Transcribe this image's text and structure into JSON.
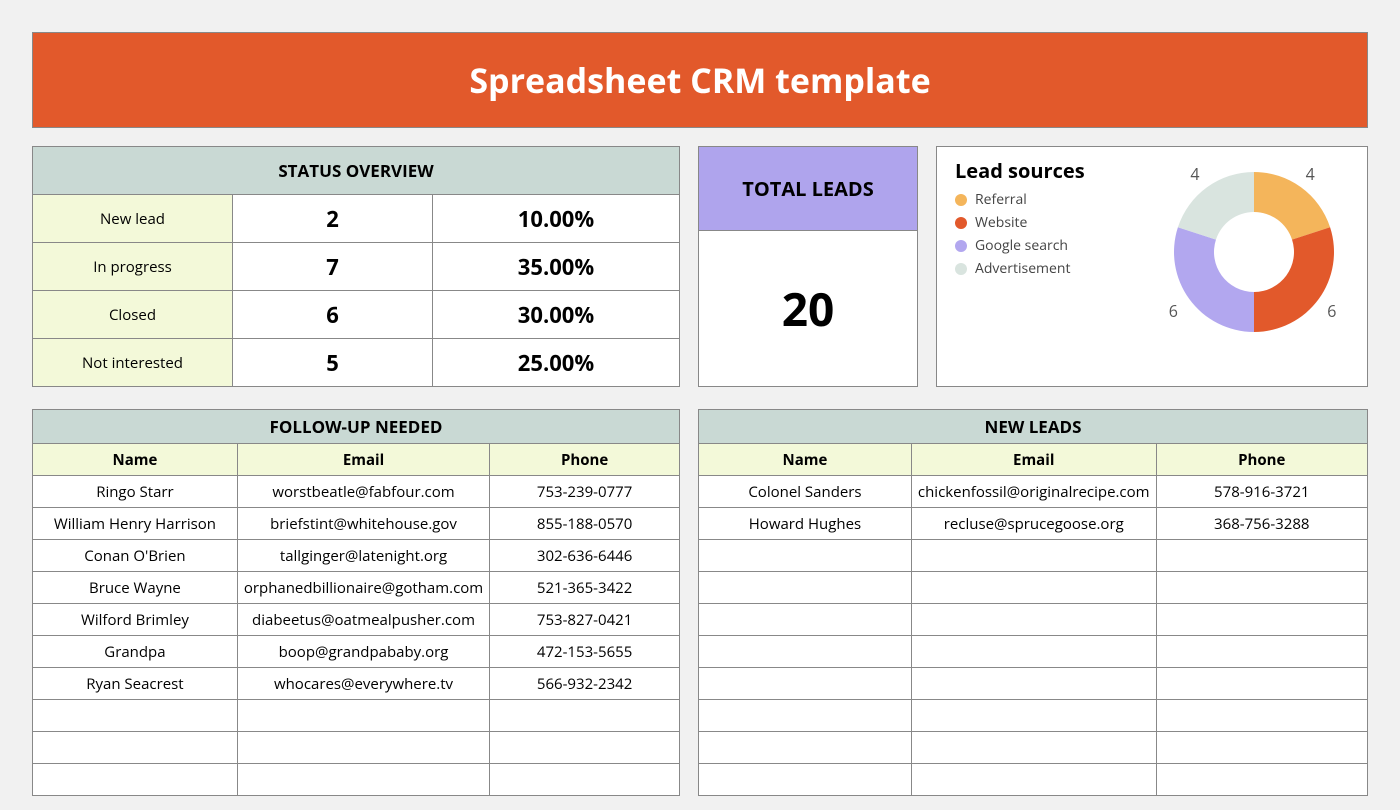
{
  "title": "Spreadsheet CRM template",
  "status": {
    "header": "STATUS OVERVIEW",
    "rows": [
      {
        "label": "New lead",
        "count": "2",
        "pct": "10.00%"
      },
      {
        "label": "In progress",
        "count": "7",
        "pct": "35.00%"
      },
      {
        "label": "Closed",
        "count": "6",
        "pct": "30.00%"
      },
      {
        "label": "Not interested",
        "count": "5",
        "pct": "25.00%"
      }
    ]
  },
  "total": {
    "header": "TOTAL LEADS",
    "value": "20"
  },
  "chart_data": {
    "type": "pie",
    "title": "Lead sources",
    "series": [
      {
        "name": "Referral",
        "value": 4,
        "color": "#f4b55b"
      },
      {
        "name": "Website",
        "value": 6,
        "color": "#e2592b"
      },
      {
        "name": "Google search",
        "value": 6,
        "color": "#b2a7ef"
      },
      {
        "name": "Advertisement",
        "value": 4,
        "color": "#d9e4df"
      }
    ]
  },
  "followup": {
    "header": "FOLLOW-UP NEEDED",
    "cols": {
      "name": "Name",
      "email": "Email",
      "phone": "Phone"
    },
    "rows": [
      {
        "name": "Ringo Starr",
        "email": "worstbeatle@fabfour.com",
        "phone": "753-239-0777"
      },
      {
        "name": "William Henry Harrison",
        "email": "briefstint@whitehouse.gov",
        "phone": "855-188-0570"
      },
      {
        "name": "Conan O'Brien",
        "email": "tallginger@latenight.org",
        "phone": "302-636-6446"
      },
      {
        "name": "Bruce Wayne",
        "email": "orphanedbillionaire@gotham.com",
        "phone": "521-365-3422"
      },
      {
        "name": "Wilford Brimley",
        "email": "diabeetus@oatmealpusher.com",
        "phone": "753-827-0421"
      },
      {
        "name": "Grandpa",
        "email": "boop@grandpababy.org",
        "phone": "472-153-5655"
      },
      {
        "name": "Ryan Seacrest",
        "email": "whocares@everywhere.tv",
        "phone": "566-932-2342"
      }
    ],
    "blank_rows": 3
  },
  "newleads": {
    "header": "NEW LEADS",
    "cols": {
      "name": "Name",
      "email": "Email",
      "phone": "Phone"
    },
    "rows": [
      {
        "name": "Colonel Sanders",
        "email": "chickenfossil@originalrecipe.com",
        "phone": "578-916-3721"
      },
      {
        "name": "Howard Hughes",
        "email": "recluse@sprucegoose.org",
        "phone": "368-756-3288"
      }
    ],
    "blank_rows": 8
  }
}
